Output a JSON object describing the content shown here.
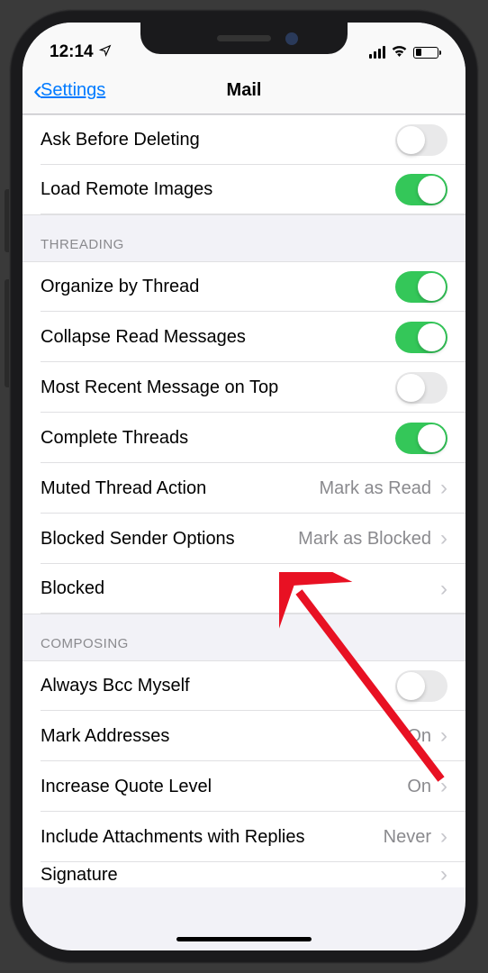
{
  "status": {
    "time": "12:14"
  },
  "nav": {
    "back": "Settings",
    "title": "Mail"
  },
  "rows": {
    "ask_delete": "Ask Before Deleting",
    "load_remote": "Load Remote Images",
    "organize": "Organize by Thread",
    "collapse": "Collapse Read Messages",
    "most_recent": "Most Recent Message on Top",
    "complete": "Complete Threads",
    "muted_action": "Muted Thread Action",
    "muted_value": "Mark as Read",
    "blocked_sender": "Blocked Sender Options",
    "blocked_value": "Mark as Blocked",
    "blocked": "Blocked",
    "always_bcc": "Always Bcc Myself",
    "mark_addr": "Mark Addresses",
    "mark_addr_value": "On",
    "quote": "Increase Quote Level",
    "quote_value": "On",
    "attach": "Include Attachments with Replies",
    "attach_value": "Never",
    "signature": "Signature"
  },
  "sections": {
    "threading": "THREADING",
    "composing": "COMPOSING"
  },
  "toggles": {
    "ask_delete": false,
    "load_remote": true,
    "organize": true,
    "collapse": true,
    "most_recent": false,
    "complete": true,
    "always_bcc": false
  }
}
